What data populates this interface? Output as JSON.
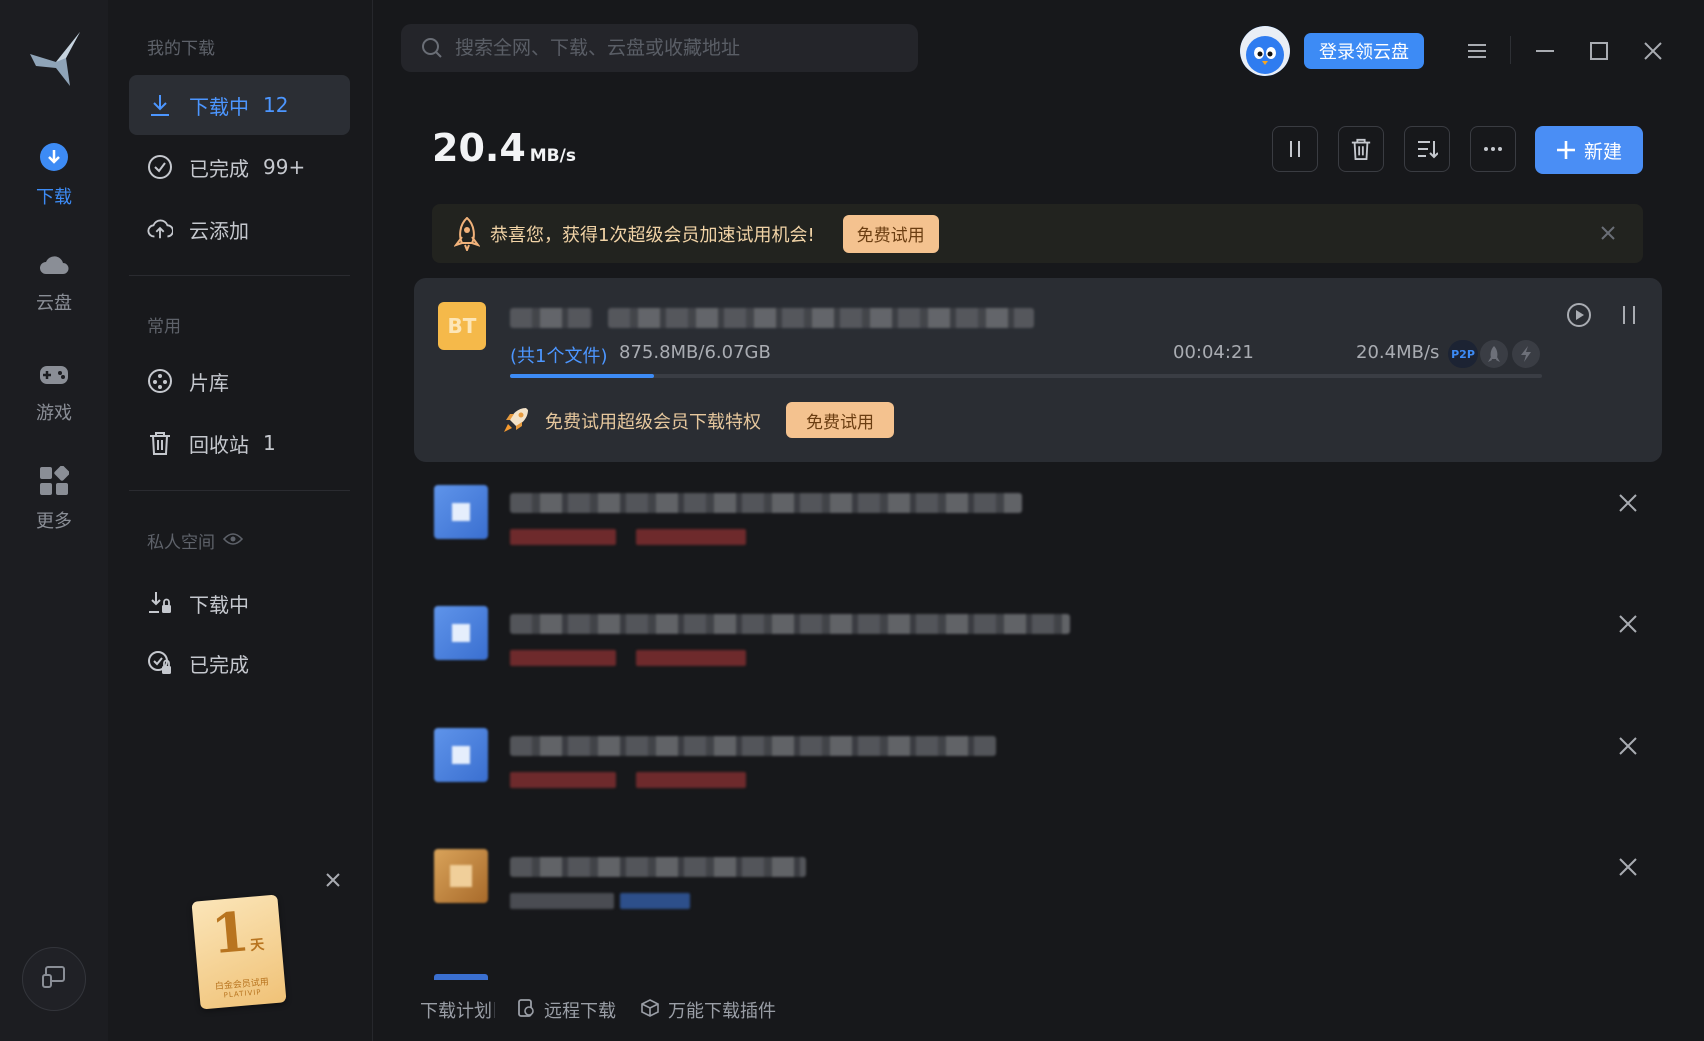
{
  "rail": {
    "items": [
      {
        "label": "下载",
        "icon": "download-circle-icon",
        "active": true
      },
      {
        "label": "云盘",
        "icon": "cloud-icon"
      },
      {
        "label": "游戏",
        "icon": "gamepad-icon"
      },
      {
        "label": "更多",
        "icon": "grid-icon"
      }
    ]
  },
  "nav": {
    "section_my": "我的下载",
    "downloading_label": "下载中",
    "downloading_count": "12",
    "completed_label": "已完成",
    "completed_count": "99+",
    "cloud_add_label": "云添加",
    "section_common": "常用",
    "library_label": "片库",
    "recycle_label": "回收站",
    "recycle_count": "1",
    "section_private": "私人空间",
    "private_downloading_label": "下载中",
    "private_completed_label": "已完成",
    "vip_card_number": "1",
    "vip_card_unit": "天",
    "vip_card_text": "白金会员试用",
    "vip_card_sub": "PLATIVIP"
  },
  "header": {
    "search_placeholder": "搜索全网、下载、云盘或收藏地址",
    "login_label": "登录领云盘"
  },
  "toolbar": {
    "speed_value": "20.4",
    "speed_unit": "MB/s",
    "new_label": "新建"
  },
  "promo": {
    "text": "恭喜您，获得1次超级会员加速试用机会!",
    "button": "免费试用"
  },
  "active_task": {
    "badge": "BT",
    "file_count": "(共1个文件)",
    "progress_text": "875.8MB/6.07GB",
    "progress": 0.14,
    "eta": "00:04:21",
    "speed": "20.4MB/s",
    "p2p_label": "P2P",
    "vip_text": "免费试用超级会员下载特权",
    "vip_button": "免费试用"
  },
  "bottom": {
    "plan": "下载计划",
    "remote": "远程下载",
    "plugin": "万能下载插件"
  },
  "colors": {
    "accent": "#4a8ef5",
    "gold": "#f4c28f"
  }
}
